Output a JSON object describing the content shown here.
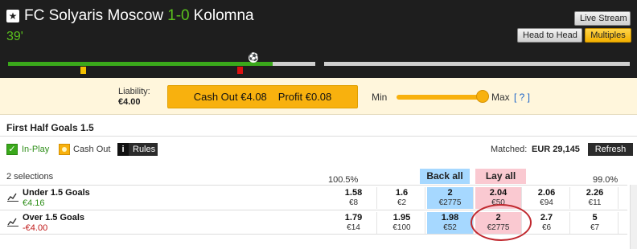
{
  "header": {
    "home_team": "FC Solyaris Moscow",
    "score": "1-0",
    "away_team": "Kolomna",
    "clock": "39'",
    "star_icon": "★",
    "live_stream_label": "Live Stream",
    "head_to_head_label": "Head to Head",
    "multiples_label": "Multiples"
  },
  "timeline": {
    "ball_icon": "⚽",
    "progress_fraction": 0.86
  },
  "cashout": {
    "liability_label": "Liability:",
    "liability_value": "€4.00",
    "cashout_amount": "Cash Out €4.08",
    "profit": "Profit €0.08",
    "min_label": "Min",
    "max_label": "Max",
    "help_label": "[ ? ]"
  },
  "market": {
    "title": "First Half Goals 1.5",
    "inplay_label": "In-Play",
    "cashout_label": "Cash Out",
    "info_icon": "i",
    "rules_label": "Rules",
    "matched_label": "Matched:",
    "matched_value": "EUR 29,145",
    "refresh_label": "Refresh",
    "selections_label": "2 selections",
    "back_pct": "100.5%",
    "lay_pct": "99.0%",
    "back_all_label": "Back all",
    "lay_all_label": "Lay all"
  },
  "runners": [
    {
      "name": "Under 1.5 Goals",
      "pl": "€4.16",
      "prices": [
        {
          "odds": "1.58",
          "size": "€8"
        },
        {
          "odds": "1.6",
          "size": "€2"
        },
        {
          "odds": "2",
          "size": "€2775"
        },
        {
          "odds": "2.04",
          "size": "€50"
        },
        {
          "odds": "2.06",
          "size": "€94"
        },
        {
          "odds": "2.26",
          "size": "€11"
        }
      ]
    },
    {
      "name": "Over 1.5 Goals",
      "pl": "-€4.00",
      "prices": [
        {
          "odds": "1.79",
          "size": "€14"
        },
        {
          "odds": "1.95",
          "size": "€100"
        },
        {
          "odds": "1.98",
          "size": "€52"
        },
        {
          "odds": "2",
          "size": "€2775"
        },
        {
          "odds": "2.7",
          "size": "€6"
        },
        {
          "odds": "5",
          "size": "€7"
        }
      ]
    }
  ],
  "colors": {
    "header_bg": "#1e1e1e",
    "score_green": "#5ac11d",
    "cashout_orange": "#f8b10e",
    "back_blue": "#a6d8ff",
    "lay_pink": "#fac9d1",
    "annotation_red": "#c0282e"
  }
}
